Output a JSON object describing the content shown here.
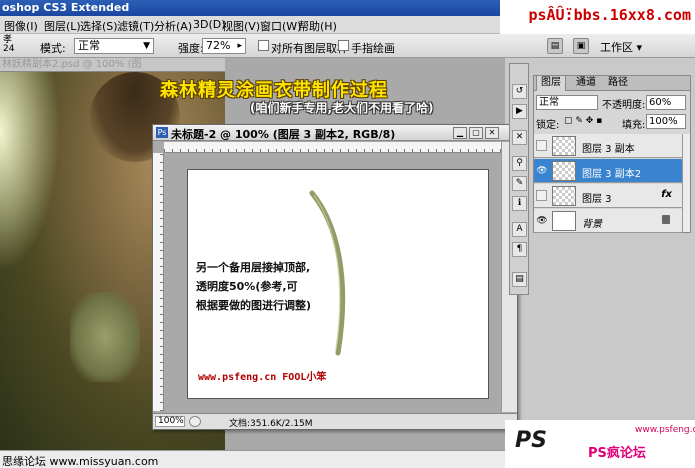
{
  "app": {
    "title": "oshop CS3 Extended",
    "site_url": "psÂÛ̈:bbs.16xx8.com"
  },
  "menubar": {
    "items": [
      "图像(I)",
      "图层(L)",
      "选择(S)",
      "滤镜(T)",
      "分析(A)",
      "3D(D)",
      "视图(V)",
      "窗口(W)",
      "帮助(H)"
    ]
  },
  "options": {
    "brush_size": "24",
    "brush_prefix": "孝",
    "mode_label": "模式:",
    "mode_value": "正常",
    "strength_label": "强度:",
    "strength_value": "72%",
    "sample_all_label": "对所有图层取样",
    "finger_paint_label": "手指绘画",
    "workspace_label": "工作区 ▾"
  },
  "background_doc": {
    "tab_title": "林妖精副本2.psd @ 100% (图"
  },
  "overlay": {
    "title": "森林精灵涂画衣带制作过程",
    "subtitle": "(咱们新手专用,老大们不用看了哈)"
  },
  "document": {
    "title": "未标题-2 @ 100% (图层 3 副本2, RGB/8)",
    "note_lines": [
      "另一个备用层接掉顶部,",
      "透明度50%(参考,可",
      "根据要做的图进行调整)"
    ],
    "credit": "www.psfeng.cn  FOOL小笨",
    "zoom": "100%",
    "doc_size": "文档:351.6K/2.15M"
  },
  "layers_panel": {
    "tabs": [
      "图层",
      "通道",
      "路径"
    ],
    "blend_mode": "正常",
    "opacity_label": "不透明度:",
    "opacity_value": "60%",
    "lock_label": "锁定:",
    "fill_label": "填充:",
    "fill_value": "100%",
    "layers": [
      {
        "name": "图层 3 副本",
        "visible": false,
        "selected": false
      },
      {
        "name": "图层 3 副本2",
        "visible": true,
        "selected": true
      },
      {
        "name": "图层 3",
        "visible": false,
        "selected": false,
        "fx": "fx"
      },
      {
        "name": "背景",
        "visible": true,
        "selected": false
      }
    ]
  },
  "footer": {
    "left_text": "思缘论坛 www.missyuan.com",
    "logo_text": "PS",
    "logo_url": "www.psfeng.cn",
    "logo_name": "PS疯论坛"
  }
}
